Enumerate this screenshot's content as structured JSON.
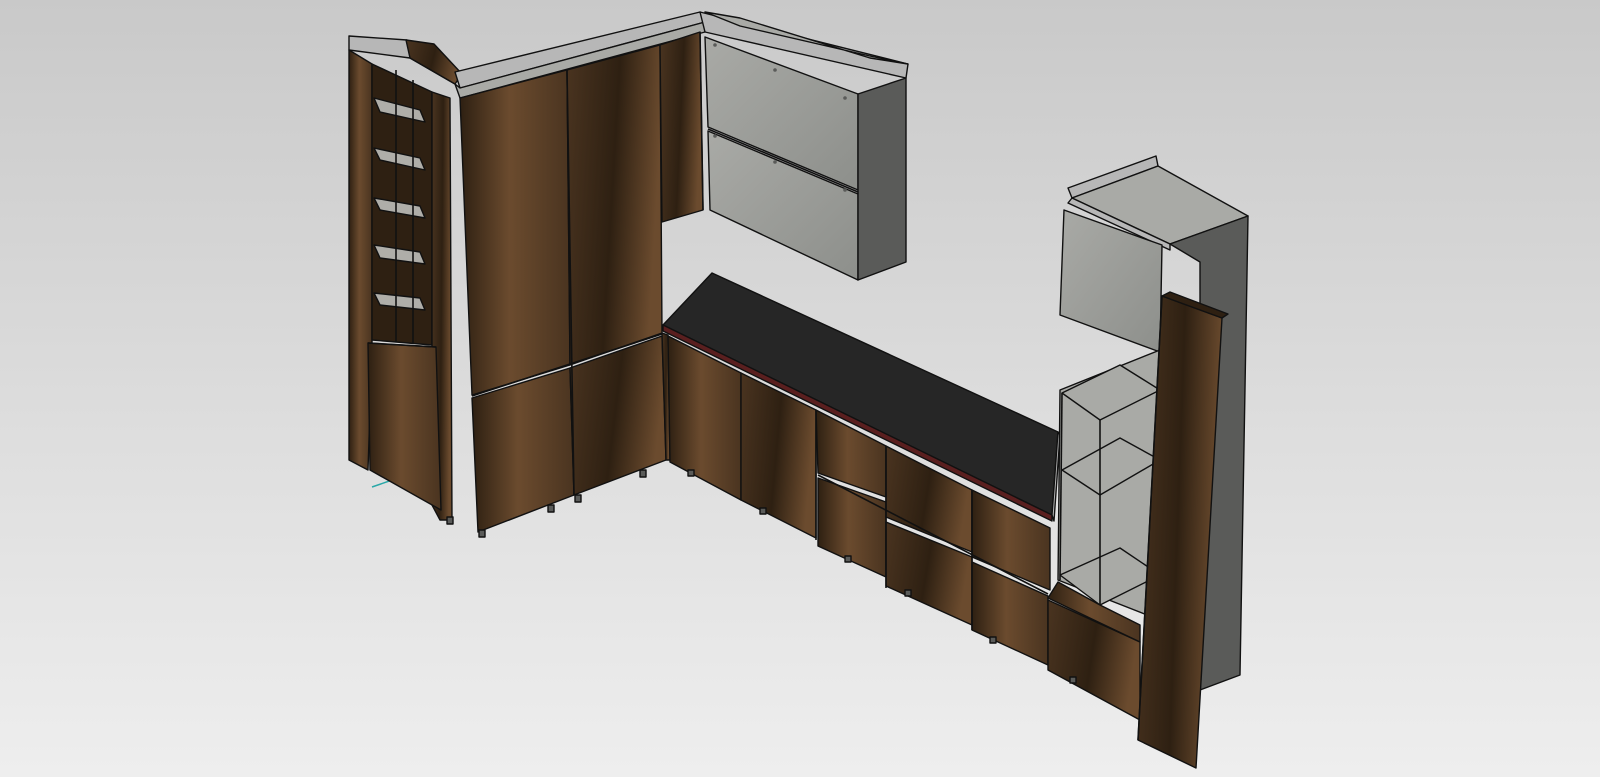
{
  "viewport": {
    "background_top": "#c9c9c9",
    "background_bottom": "#eeeeee"
  },
  "materials": {
    "wood_dark": "#2e2012",
    "wood_mid": "#4a3420",
    "wood_light": "#6b4b2e",
    "panel_grey": "#8d8f8b",
    "panel_grey_dark": "#5a5b59",
    "panel_grey_light": "#a9aaa6",
    "frame_silver": "#b7b7b7",
    "countertop": "#262626",
    "outline": "#111111",
    "glass": "#cfd2d0",
    "axis_teal": "#2aa8a8"
  },
  "model": {
    "parts": [
      "tall-shelf-unit",
      "tall-pantry-cabinet",
      "corner-upper-cabinet",
      "grey-wall-cabinet",
      "base-cabinet-run",
      "countertop",
      "open-shelf-tower",
      "end-side-panel",
      "axis-triad"
    ]
  }
}
